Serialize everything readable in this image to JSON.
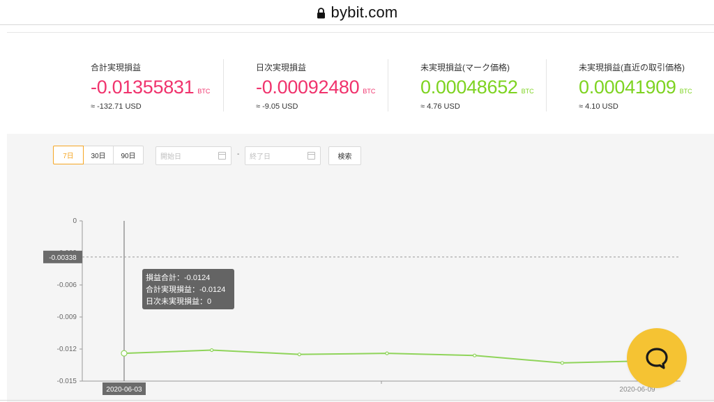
{
  "browser": {
    "domain": "bybit.com"
  },
  "stats": [
    {
      "label": "合計実現損益",
      "value": "-0.01355831",
      "unit": "BTC",
      "usd": "≈ -132.71 USD",
      "tone": "neg"
    },
    {
      "label": "日次実現損益",
      "value": "-0.00092480",
      "unit": "BTC",
      "usd": "≈ -9.05 USD",
      "tone": "neg"
    },
    {
      "label": "未実現損益(マーク価格)",
      "value": "0.00048652",
      "unit": "BTC",
      "usd": "≈ 4.76 USD",
      "tone": "pos"
    },
    {
      "label": "未実現損益(直近の取引価格)",
      "value": "0.00041909",
      "unit": "BTC",
      "usd": "≈ 4.10 USD",
      "tone": "pos"
    }
  ],
  "filters": {
    "ranges": [
      "7日",
      "30日",
      "90日"
    ],
    "active_range": "7日",
    "start_placeholder": "開始日",
    "end_placeholder": "終了日",
    "separator": "-",
    "search_label": "検索"
  },
  "tooltip": {
    "line1": "損益合計：-0.0124",
    "line2": "合計実現損益：-0.0124",
    "line3": "日次未実現損益：0"
  },
  "chart_data": {
    "type": "line",
    "y_ticks": [
      "0",
      "-0.003",
      "-0.006",
      "-0.009",
      "-0.012",
      "-0.015"
    ],
    "ylim": [
      -0.015,
      0
    ],
    "x_labels": [
      "2020-06-03",
      "2020-06-09"
    ],
    "reference_line": {
      "label": "-0.00338",
      "value": -0.00338
    },
    "series": [
      {
        "values": [
          -0.0124,
          -0.0121,
          -0.0125,
          -0.0124,
          -0.0126,
          -0.0133,
          -0.0131
        ]
      }
    ],
    "line_color": "#8fd45a",
    "point_count": 7
  },
  "colors": {
    "negative": "#f0336d",
    "positive": "#7ed321",
    "accent": "#f5a623",
    "chat": "#f5c333"
  },
  "icons": {
    "lock": "lock-icon",
    "calendar": "calendar-icon",
    "chat": "chat-bubble-icon"
  }
}
